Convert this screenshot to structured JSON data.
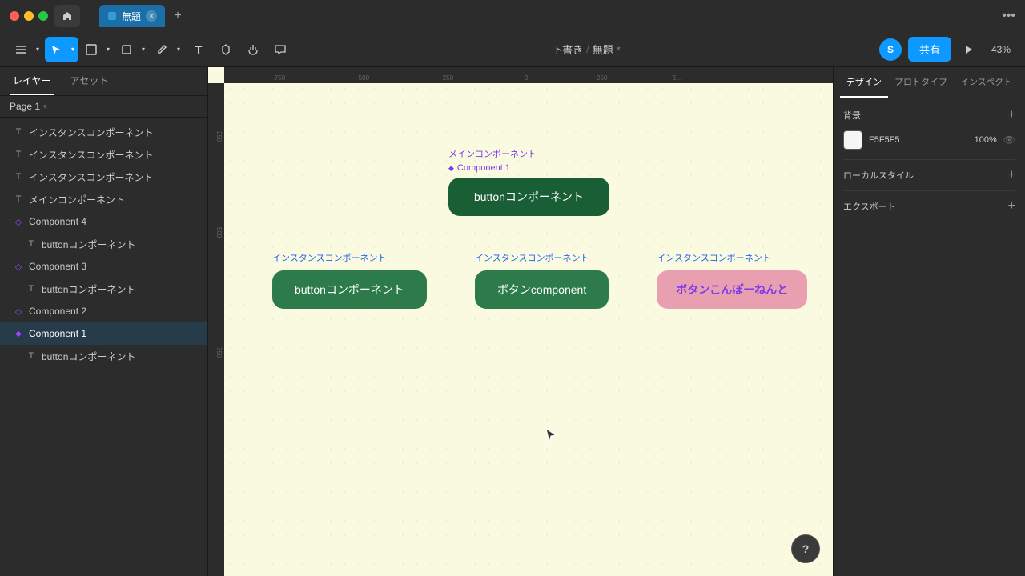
{
  "titlebar": {
    "tab_label": "無題",
    "tab_close": "×",
    "tab_add": "+",
    "more_icon": "•••"
  },
  "toolbar": {
    "breadcrumb_parent": "下書き",
    "breadcrumb_sep": "/",
    "breadcrumb_current": "無題",
    "share_label": "共有",
    "zoom_level": "43%",
    "avatar_label": "S"
  },
  "left_panel": {
    "tab_layers": "レイヤー",
    "tab_assets": "アセット",
    "page_label": "Page 1",
    "layers": [
      {
        "label": "インスタンスコンポーネント",
        "type": "text",
        "indent": false
      },
      {
        "label": "インスタンスコンポーネント",
        "type": "text",
        "indent": false
      },
      {
        "label": "インスタンスコンポーネント",
        "type": "text",
        "indent": false
      },
      {
        "label": "メインコンポーネント",
        "type": "text",
        "indent": false
      },
      {
        "label": "Component 4",
        "type": "diamond",
        "indent": false
      },
      {
        "label": "buttonコンポーネント",
        "type": "text",
        "indent": true
      },
      {
        "label": "Component 3",
        "type": "diamond",
        "indent": false
      },
      {
        "label": "buttonコンポーネント",
        "type": "text",
        "indent": true
      },
      {
        "label": "Component 2",
        "type": "diamond",
        "indent": false
      },
      {
        "label": "Component 1",
        "type": "main-component",
        "indent": false,
        "selected": true
      },
      {
        "label": "buttonコンポーネント",
        "type": "text",
        "indent": true
      }
    ]
  },
  "right_panel": {
    "tab_design": "デザイン",
    "tab_prototype": "プロトタイプ",
    "tab_inspect": "インスペクト",
    "section_background": "背景",
    "section_local_styles": "ローカルスタイル",
    "section_export": "エクスポート",
    "bg_color": "F5F5F5",
    "bg_opacity": "100%"
  },
  "canvas": {
    "main_component_label": "メインコンポーネント",
    "component1_badge": "Component 1",
    "main_button_text": "buttonコンポーネント",
    "instance_labels": [
      "インスタンスコンポーネント",
      "インスタンスコンポーネント",
      "インスタンスコンポーネント"
    ],
    "instance_buttons": [
      "buttonコンポーネント",
      "ボタンcomponent",
      "ボタンこんぽーねんと"
    ]
  },
  "help": {
    "label": "?"
  }
}
